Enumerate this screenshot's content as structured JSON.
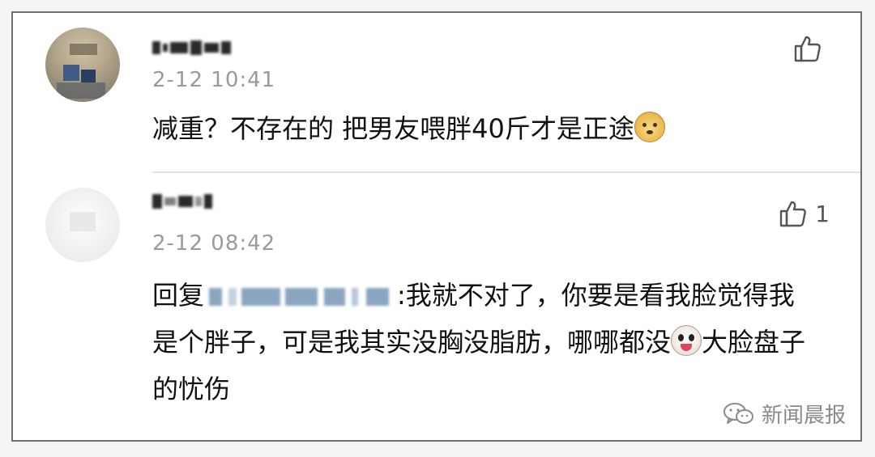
{
  "comments": [
    {
      "timestamp": "2-12 10:41",
      "text": "减重？不存在的 把男友喂胖40斤才是正途",
      "emoji": "doge-emoji",
      "likes": ""
    },
    {
      "timestamp": "2-12 08:42",
      "reply_prefix": "回复",
      "text_after_mention": ":我就不对了，你要是看我脸觉得我是个胖子，可是我其实没胸没脂肪，哪哪都没",
      "emoji": "crying-face-emoji",
      "text_tail": "大脸盘子的忧伤",
      "likes": "1"
    }
  ],
  "watermark": {
    "label": "新闻晨报",
    "icon": "wechat-icon"
  },
  "icons": {
    "like": "thumbs-up-icon"
  },
  "colors": {
    "text": "#111111",
    "timestamp": "#9a9a9a",
    "border": "#6f6f6f",
    "watermark": "#8a8a8a"
  }
}
